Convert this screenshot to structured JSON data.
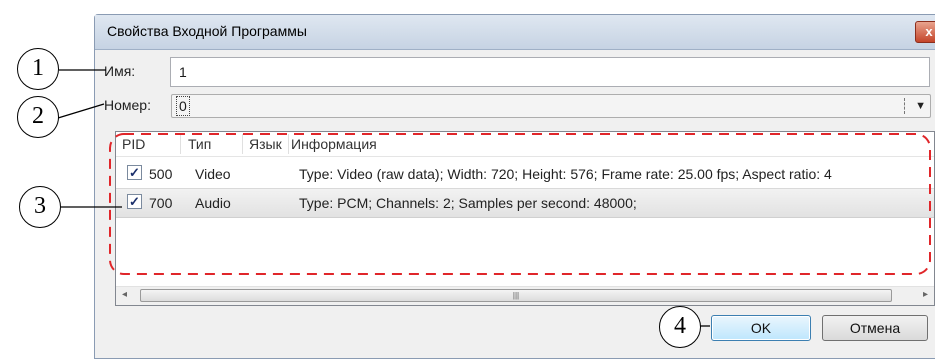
{
  "dialog": {
    "title": "Свойства Входной Программы",
    "close_glyph": "x"
  },
  "form": {
    "name_label": "Имя:",
    "name_value": "1",
    "number_label": "Номер:",
    "number_value": "0",
    "number_arrow": "▼"
  },
  "table": {
    "columns": [
      "PID",
      "Тип",
      "Язык",
      "Информация"
    ],
    "rows": [
      {
        "checked": true,
        "pid": "500",
        "type": "Video",
        "lang": "",
        "info": "Type: Video (raw data); Width: 720; Height: 576; Frame rate: 25.00 fps; Aspect ratio: 4"
      },
      {
        "checked": true,
        "pid": "700",
        "type": "Audio",
        "lang": "",
        "info": "Type: PCM; Channels: 2; Samples per second: 48000;"
      }
    ],
    "scroll_left": "◂",
    "scroll_right": "▸",
    "scroll_grip": "|||"
  },
  "buttons": {
    "ok_label": "OK",
    "cancel_label": "Отмена"
  },
  "callouts": [
    "1",
    "2",
    "3",
    "4"
  ],
  "colors": {
    "callout_dash": "#e0262a",
    "selection_row": "#e6e6e6",
    "default_button": "#bee6fd"
  }
}
